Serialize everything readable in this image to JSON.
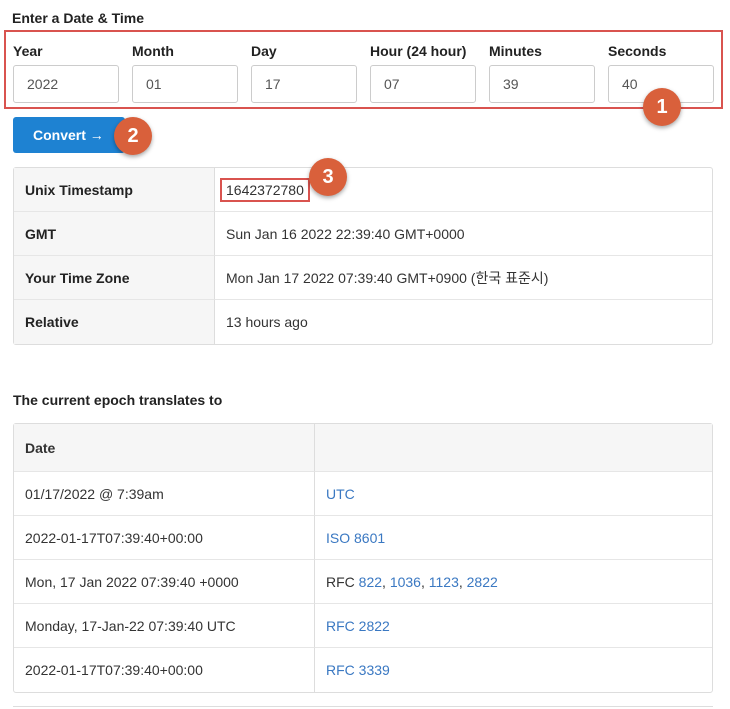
{
  "form": {
    "heading": "Enter a Date & Time",
    "fields": [
      {
        "label": "Year",
        "value": "2022"
      },
      {
        "label": "Month",
        "value": "01"
      },
      {
        "label": "Day",
        "value": "17"
      },
      {
        "label": "Hour (24 hour)",
        "value": "07"
      },
      {
        "label": "Minutes",
        "value": "39"
      },
      {
        "label": "Seconds",
        "value": "40"
      }
    ],
    "convert_label": "Convert →",
    "accent_color": "#1e82d2"
  },
  "annotations": {
    "badges": [
      "1",
      "2",
      "3"
    ],
    "badge_color": "#d9603b",
    "box_color": "#d9534f"
  },
  "result": {
    "rows": [
      {
        "key": "Unix Timestamp",
        "value": "1642372780"
      },
      {
        "key": "GMT",
        "value": "Sun Jan 16 2022 22:39:40 GMT+0000"
      },
      {
        "key": "Your Time Zone",
        "value": "Mon Jan 17 2022 07:39:40 GMT+0900 (한국 표준시)"
      },
      {
        "key": "Relative",
        "value": "13 hours ago"
      }
    ]
  },
  "epoch": {
    "heading": "The current epoch translates to",
    "header": "Date",
    "rows": [
      {
        "date": "01/17/2022 @ 7:39am",
        "format": "UTC"
      },
      {
        "date": "2022-01-17T07:39:40+00:00",
        "format": "ISO 8601"
      },
      {
        "date": "Mon, 17 Jan 2022 07:39:40 +0000",
        "format_prefix": "RFC",
        "rfc_links": [
          "822",
          "1036",
          "1123",
          "2822"
        ]
      },
      {
        "date": "Monday, 17-Jan-22 07:39:40 UTC",
        "format": "RFC 2822"
      },
      {
        "date": "2022-01-17T07:39:40+00:00",
        "format": "RFC 3339"
      }
    ],
    "link_color": "#3a78c2"
  }
}
